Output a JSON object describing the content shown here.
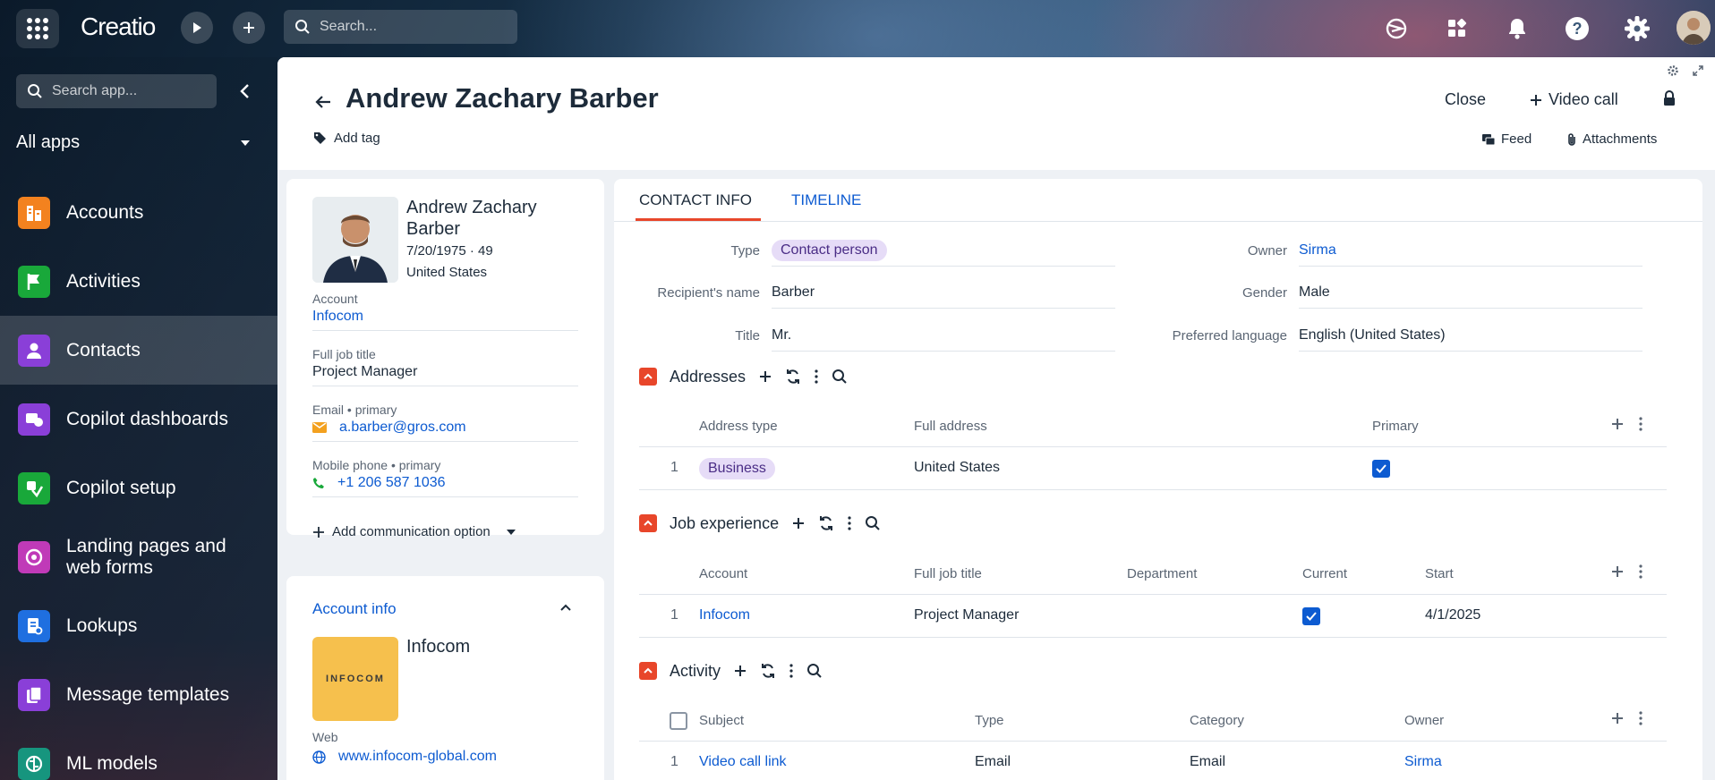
{
  "app": {
    "logo": "Creatio"
  },
  "topbar": {
    "search_placeholder": "Search..."
  },
  "sidebar": {
    "search_placeholder": "Search app...",
    "all_apps": "All apps",
    "items": [
      {
        "label": "Accounts",
        "icon": "accounts-icon",
        "color": "#f3821f"
      },
      {
        "label": "Activities",
        "icon": "flag-icon",
        "color": "#19a83a"
      },
      {
        "label": "Contacts",
        "icon": "person-icon",
        "color": "#8a3fd8"
      },
      {
        "label": "Copilot dashboards",
        "icon": "copilot-dashboard-icon",
        "color": "#8a3fd8"
      },
      {
        "label": "Copilot setup",
        "icon": "copilot-setup-icon",
        "color": "#19a83a"
      },
      {
        "label": "Landing pages and web forms",
        "icon": "target-icon",
        "color": "#c03ab8"
      },
      {
        "label": "Lookups",
        "icon": "lookup-icon",
        "color": "#1f6fe0"
      },
      {
        "label": "Message templates",
        "icon": "template-icon",
        "color": "#8a3fd8"
      },
      {
        "label": "ML models",
        "icon": "brain-icon",
        "color": "#16957e"
      }
    ]
  },
  "header": {
    "title": "Andrew Zachary Barber",
    "add_tag": "Add tag",
    "close": "Close",
    "video_call": "Video call",
    "feed": "Feed",
    "attachments": "Attachments"
  },
  "profile": {
    "name": "Andrew Zachary Barber",
    "birth": "7/20/1975 · 49",
    "country": "United States",
    "account_label": "Account",
    "account": "Infocom",
    "job_label": "Full job title",
    "job": "Project Manager",
    "email_label": "Email • primary",
    "email": "a.barber@gros.com",
    "phone_label": "Mobile phone • primary",
    "phone": "+1 206 587 1036",
    "add_comm": "Add communication option"
  },
  "account_info": {
    "title": "Account info",
    "logo_text": "INFOCOM",
    "name": "Infocom",
    "web_label": "Web",
    "web": "www.infocom-global.com"
  },
  "tabs": {
    "contact_info": "CONTACT INFO",
    "timeline": "TIMELINE"
  },
  "fields": {
    "type_label": "Type",
    "type": "Contact person",
    "recipient_label": "Recipient's name",
    "recipient": "Barber",
    "title_label": "Title",
    "title": "Mr.",
    "owner_label": "Owner",
    "owner": "Sirma",
    "gender_label": "Gender",
    "gender": "Male",
    "language_label": "Preferred language",
    "language": "English (United States)"
  },
  "addresses": {
    "title": "Addresses",
    "columns": [
      "Address type",
      "Full address",
      "Primary"
    ],
    "rows": [
      {
        "n": "1",
        "type": "Business",
        "address": "United States",
        "primary": true
      }
    ]
  },
  "job_experience": {
    "title": "Job experience",
    "columns": [
      "Account",
      "Full job title",
      "Department",
      "Current",
      "Start"
    ],
    "rows": [
      {
        "n": "1",
        "account": "Infocom",
        "job": "Project Manager",
        "department": "",
        "current": true,
        "start": "4/1/2025"
      }
    ]
  },
  "activity": {
    "title": "Activity",
    "columns": [
      "Subject",
      "Type",
      "Category",
      "Owner"
    ],
    "rows": [
      {
        "n": "1",
        "subject": "Video call link",
        "type": "Email",
        "category": "Email",
        "owner": "Sirma"
      }
    ]
  }
}
